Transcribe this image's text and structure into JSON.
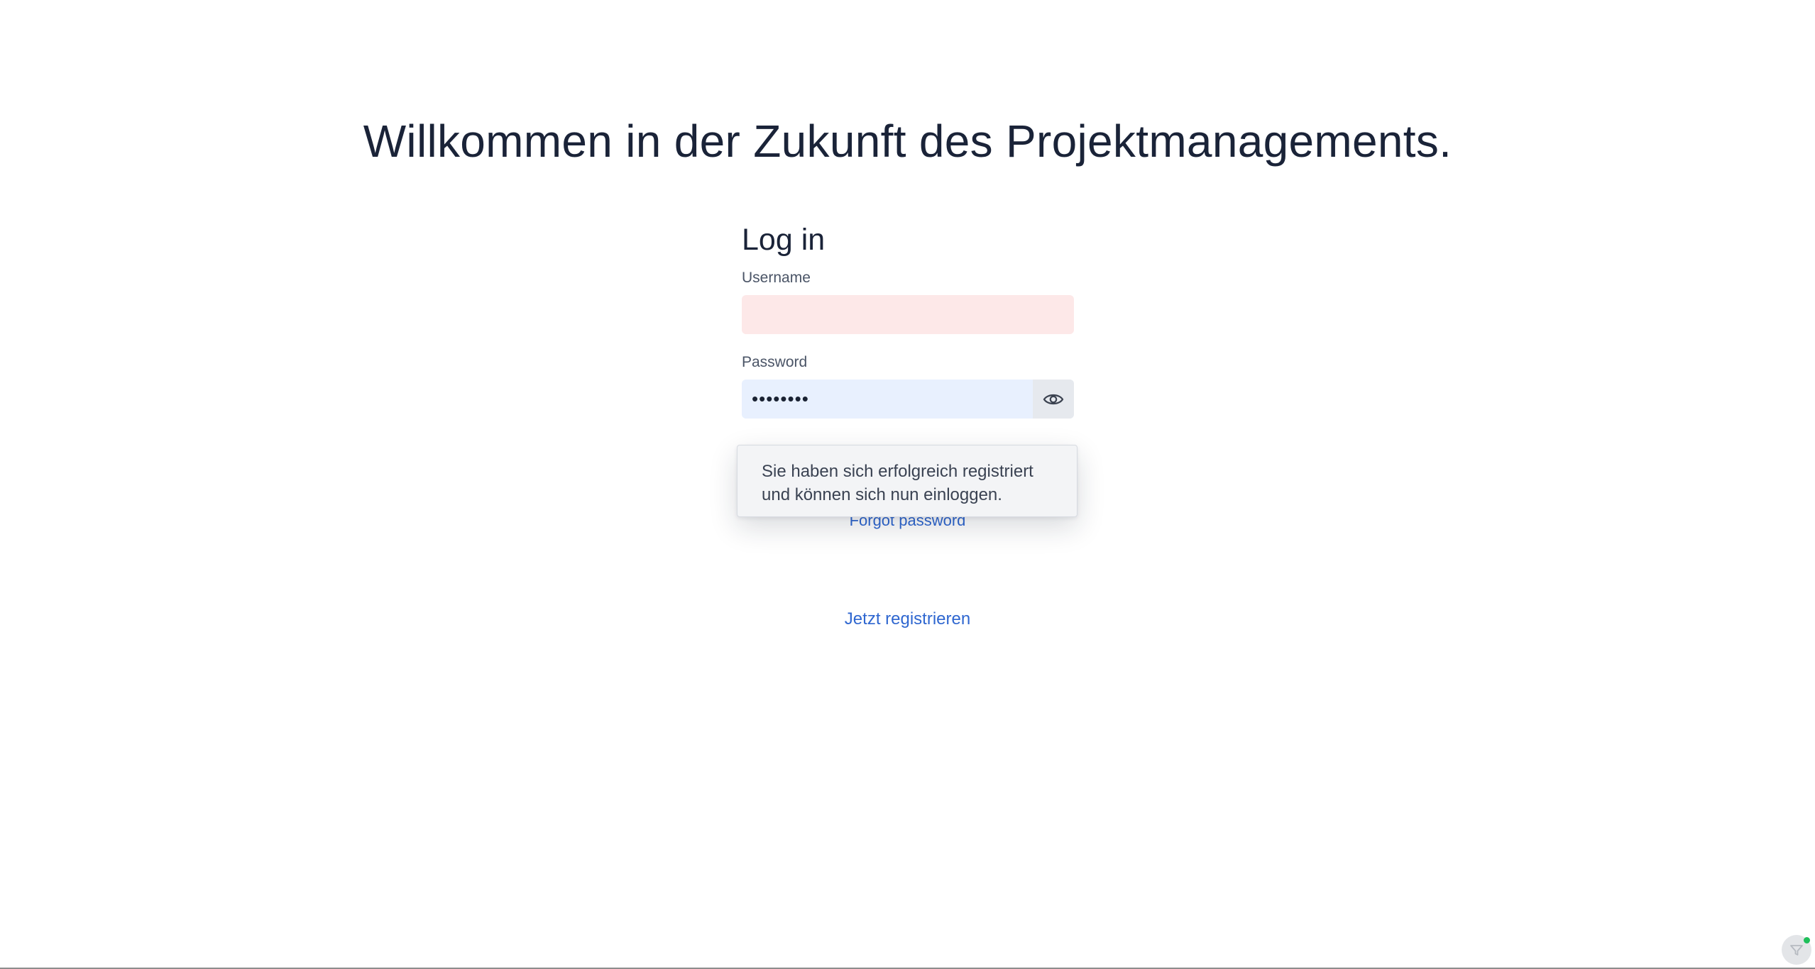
{
  "header": {
    "title": "Willkommen in der Zukunft des Projektmanagements."
  },
  "login": {
    "heading": "Log in",
    "username": {
      "label": "Username",
      "value": "",
      "placeholder": ""
    },
    "password": {
      "label": "Password",
      "value": "••••••••",
      "toggle_icon": "eye-icon"
    },
    "forgot_password_label": "Forgot password"
  },
  "toast": {
    "line1": "Sie haben sich erfolgreich registriert",
    "line2": "und können sich nun einloggen."
  },
  "footer": {
    "register_label": "Jetzt registrieren"
  },
  "colors": {
    "title": "#1a2338",
    "link": "#2f67d0",
    "username_invalid_bg": "#fde8e8",
    "password_autofill_bg": "#e8f0fe",
    "toast_bg": "#f3f4f6",
    "status_dot": "#1fbf5a"
  }
}
